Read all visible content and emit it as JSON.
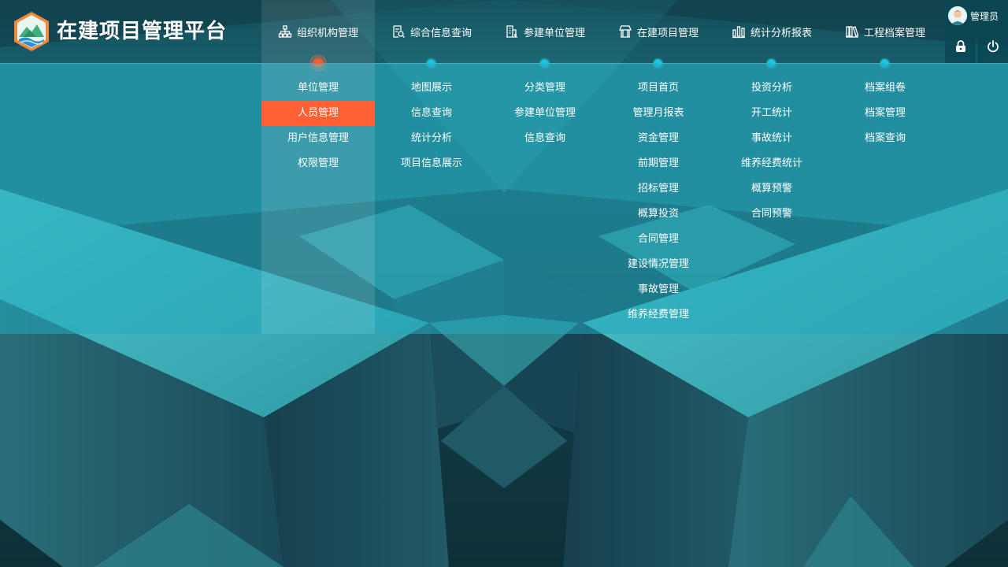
{
  "app": {
    "title": "在建项目管理平台",
    "logo_icon": "mountain-water-logo-icon"
  },
  "colors": {
    "accent": "#ff6132",
    "dot": "#1fc1dc",
    "panel": "#24aabe"
  },
  "nav": {
    "active_index": 0,
    "items": [
      {
        "label": "组织机构管理",
        "icon": "org-chart-icon"
      },
      {
        "label": "综合信息查询",
        "icon": "document-search-icon"
      },
      {
        "label": "参建单位管理",
        "icon": "building-icon"
      },
      {
        "label": "在建项目管理",
        "icon": "shop-icon"
      },
      {
        "label": "统计分析报表",
        "icon": "bar-chart-icon"
      },
      {
        "label": "工程档案管理",
        "icon": "archive-books-icon"
      }
    ]
  },
  "user": {
    "name": "管理员",
    "avatar_icon": "user-avatar-icon",
    "lock_icon": "lock-icon",
    "power_icon": "power-icon"
  },
  "menus": [
    {
      "items": [
        "单位管理",
        "人员管理",
        "用户信息管理",
        "权限管理"
      ],
      "selected": 1
    },
    {
      "items": [
        "地图展示",
        "信息查询",
        "统计分析",
        "项目信息展示"
      ]
    },
    {
      "items": [
        "分类管理",
        "参建单位管理",
        "信息查询"
      ]
    },
    {
      "items": [
        "项目首页",
        "管理月报表",
        "资金管理",
        "前期管理",
        "招标管理",
        "概算投资",
        "合同管理",
        "建设情况管理",
        "事故管理",
        "维养经费管理"
      ]
    },
    {
      "items": [
        "投资分析",
        "开工统计",
        "事故统计",
        "维养经费统计",
        "概算预警",
        "合同预警"
      ]
    },
    {
      "items": [
        "档案组卷",
        "档案管理",
        "档案查询"
      ]
    }
  ]
}
